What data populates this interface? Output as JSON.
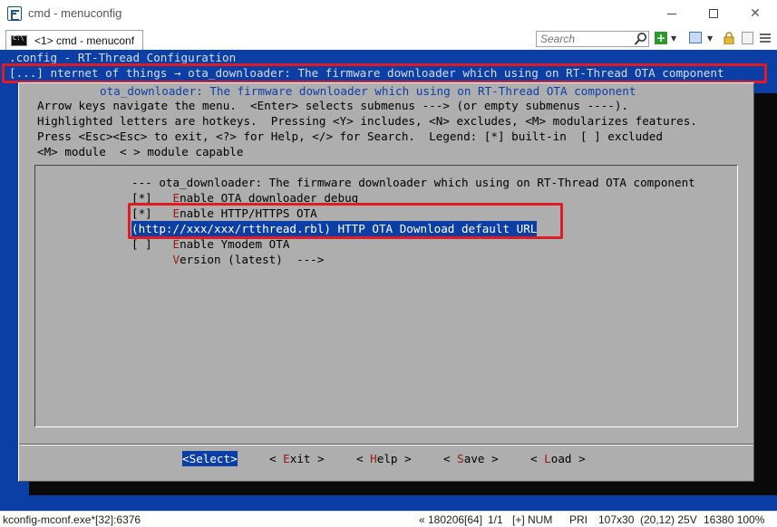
{
  "window": {
    "title": "cmd - menuconfig",
    "minimize_glyph": "",
    "maximize_glyph": "",
    "close_glyph": "✕"
  },
  "tabbar": {
    "tab_label": "<1> cmd - menuconf",
    "search_placeholder": "Search",
    "plus_glyph": "+",
    "dropdown_glyph": "▼"
  },
  "console": {
    "config_title": ".config - RT-Thread Configuration",
    "breadcrumb": "[...] nternet of things → ota_downloader: The firmware downloader which using on RT-Thread OTA component",
    "colors": {
      "background": "#0b3fa6",
      "dialog": "#aeaeae",
      "hotkey": "#9b1a10",
      "highlight_box": "#e01b24"
    },
    "dialog": {
      "title": "ota_downloader: The firmware downloader which using on RT-Thread OTA component",
      "help": [
        "Arrow keys navigate the menu.  <Enter> selects submenus ---> (or empty submenus ----).",
        "Highlighted letters are hotkeys.  Pressing <Y> includes, <N> excludes, <M> modularizes features.",
        "Press <Esc><Esc> to exit, <?> for Help, </> for Search.  Legend: [*] built-in  [ ] excluded",
        "<M> module  < > module capable"
      ],
      "menu_header": "--- ota_downloader: The firmware downloader which using on RT-Thread OTA component",
      "items": [
        {
          "prefix": "[*]   ",
          "hotkey": "E",
          "rest": "nable OTA downloader debug"
        },
        {
          "prefix": "[*]   ",
          "hotkey": "E",
          "rest": "nable HTTP/HTTPS OTA"
        },
        {
          "prefix": "(",
          "hotkey": "h",
          "rest": "ttp://xxx/xxx/rtthread.rbl) HTTP OTA Download default URL"
        },
        {
          "prefix": "[ ]   ",
          "hotkey": "E",
          "rest": "nable Ymodem OTA"
        },
        {
          "prefix": "      ",
          "hotkey": "V",
          "rest": "ersion (latest)  --->"
        }
      ],
      "buttons": [
        {
          "pre": "<",
          "hotkey": "S",
          "rest": "elect>"
        },
        {
          "pre": "< ",
          "hotkey": "E",
          "rest": "xit >"
        },
        {
          "pre": "< ",
          "hotkey": "H",
          "rest": "elp >"
        },
        {
          "pre": "< ",
          "hotkey": "S",
          "rest": "ave >"
        },
        {
          "pre": "< ",
          "hotkey": "L",
          "rest": "oad >"
        }
      ]
    }
  },
  "statusbar": {
    "process": "kconfig-mconf.exe*[32]:6376",
    "build": "« 180206[64]",
    "position": "1/1",
    "num": "[+] NUM",
    "pri": "PRI",
    "size": "107x30",
    "cursor": "(20,12) 25V",
    "mem": "16380 100%"
  }
}
